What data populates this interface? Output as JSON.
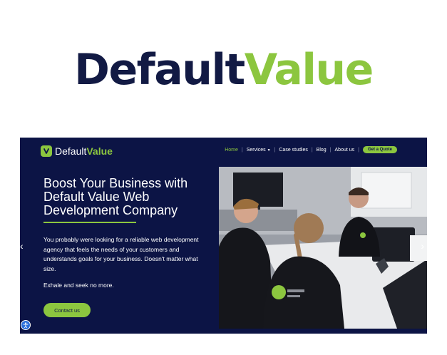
{
  "brand": {
    "logo_dark": "Default",
    "logo_green": "Value"
  },
  "site": {
    "logo": {
      "part1": "Default",
      "part2": "Value"
    },
    "nav": {
      "items": [
        {
          "label": "Home",
          "active": true
        },
        {
          "label": "Services",
          "dropdown": true
        },
        {
          "label": "Case studies"
        },
        {
          "label": "Blog"
        },
        {
          "label": "About us"
        }
      ],
      "quote_button": "Get a Quote"
    },
    "hero": {
      "title": "Boost Your Business with Default Value Web Development Company",
      "description": "You probably were looking for a reliable web development agency that feels the needs of your customers and understands goals for your business. Doesn't matter what size.",
      "tagline": "Exhale and seek no more.",
      "cta": "Contact us"
    },
    "arrows": {
      "left": "‹",
      "right": "›"
    },
    "icons": [
      "logo-mark-icon",
      "chevron-down-icon",
      "chevron-left-icon",
      "chevron-right-icon",
      "accessibility-icon"
    ]
  },
  "colors": {
    "navy": "#0c1445",
    "green": "#8cc63f",
    "logo_dark": "#121a44"
  }
}
